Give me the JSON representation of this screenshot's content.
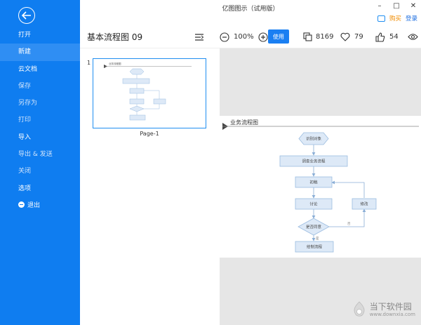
{
  "window": {
    "title": "亿图图示（试用版）",
    "controls": [
      "–",
      "□",
      "✕"
    ]
  },
  "top_links": {
    "buy": "购买",
    "login": "登录"
  },
  "sidebar": {
    "items": [
      {
        "label": "打开"
      },
      {
        "label": "新建"
      },
      {
        "label": "云文档"
      },
      {
        "label": "保存"
      },
      {
        "label": "另存为"
      },
      {
        "label": "打印"
      },
      {
        "label": "导入"
      },
      {
        "label": "导出 & 发送"
      },
      {
        "label": "关闭"
      },
      {
        "label": "选项"
      },
      {
        "label": "退出"
      }
    ]
  },
  "toolbar": {
    "doc_title": "基本流程图 09",
    "zoom": "100%",
    "use_label": "使用",
    "copies": "8169",
    "likes": "79",
    "thumbs": "54"
  },
  "thumbnails": [
    {
      "number": "1",
      "label": "Page-1"
    }
  ],
  "diagram": {
    "title": "业务流程图",
    "nodes": {
      "start": "识别对象",
      "request": "调查业务流程",
      "draft": "初稿",
      "discuss": "讨论",
      "revise": "修改",
      "decision": "是否同意",
      "end": "绘制流程"
    },
    "labels": {
      "yes": "是",
      "no": "否"
    }
  },
  "watermark": {
    "name": "当下软件园",
    "url": "www.downxia.com"
  },
  "colors": {
    "sidebar": "#0f7df0",
    "sidebar_active": "#2f8ef3",
    "accent": "#1a7ff2",
    "node_fill": "#dde9f7",
    "node_stroke": "#9bbce0",
    "canvas": "#e6e6e6"
  }
}
